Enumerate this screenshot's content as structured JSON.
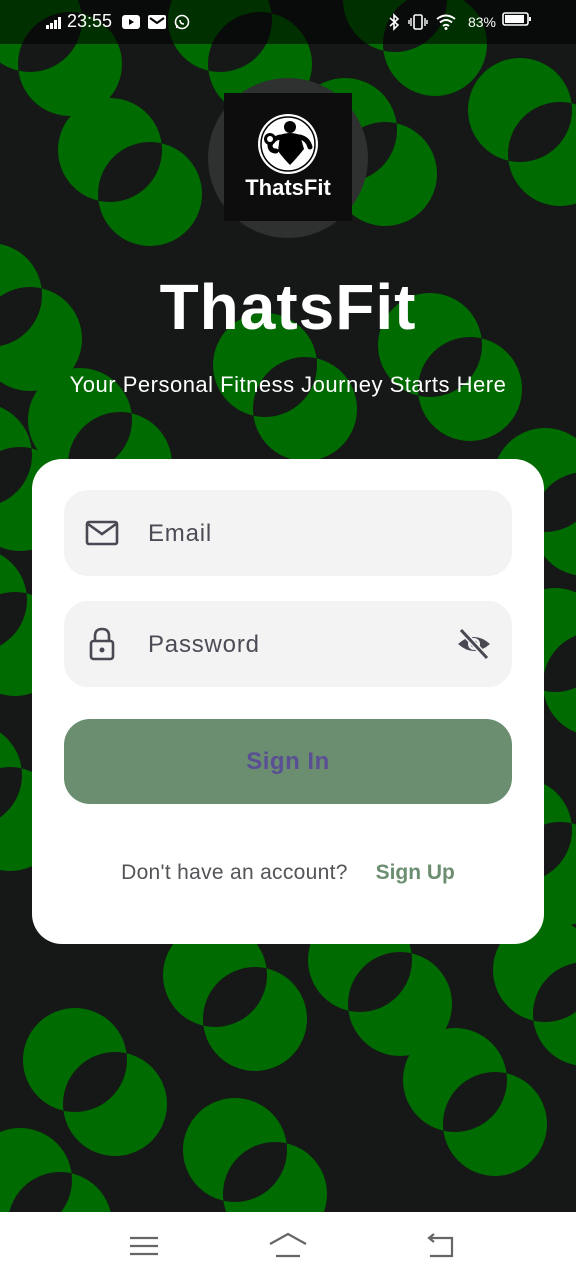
{
  "status_bar": {
    "time": "23:55",
    "battery_percent": "83%",
    "notification_icons": [
      "youtube-icon",
      "mail-icon",
      "whatsapp-icon"
    ],
    "system_icons": [
      "bluetooth-icon",
      "vibrate-icon",
      "wifi-icon",
      "battery-icon"
    ]
  },
  "logo": {
    "text": "ThatsFit",
    "icon": "bodybuilder-dumbbell-icon"
  },
  "header": {
    "title": "ThatsFit",
    "tagline": "Your Personal Fitness Journey Starts Here"
  },
  "form": {
    "email_placeholder": "Email",
    "password_placeholder": "Password",
    "email_icon": "mail-icon",
    "password_icon": "lock-icon",
    "visibility_icon": "eye-off-icon",
    "sign_in_label": "Sign In",
    "signup_prompt": "Don't have an account?",
    "signup_link": "Sign Up"
  },
  "nav_bar": {
    "buttons": [
      "menu-icon",
      "home-icon",
      "back-icon"
    ]
  },
  "colors": {
    "background": "#161817",
    "pattern_green": "#006b00",
    "accent_green": "#6b8e71",
    "button_text": "#5a4f93",
    "card": "#ffffff",
    "field_bg": "#f3f3f4"
  }
}
